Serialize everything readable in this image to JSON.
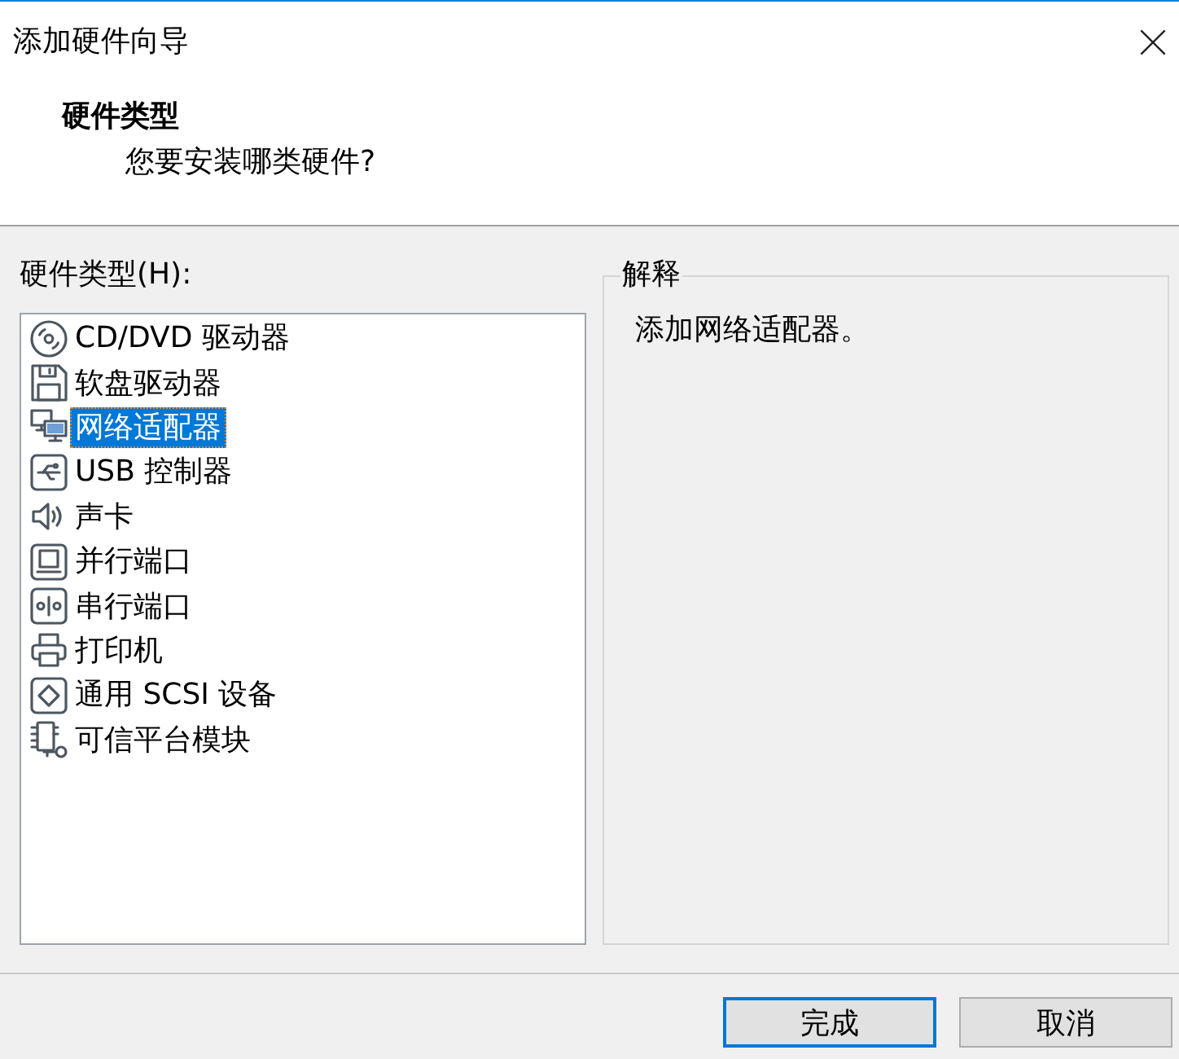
{
  "window": {
    "title": "添加硬件向导"
  },
  "header": {
    "title": "硬件类型",
    "subtitle": "您要安装哪类硬件?"
  },
  "hardware_list": {
    "label": "硬件类型(H):",
    "items": [
      {
        "label": "CD/DVD 驱动器",
        "kind": "disc",
        "selected": false
      },
      {
        "label": "软盘驱动器",
        "kind": "floppy",
        "selected": false
      },
      {
        "label": "网络适配器",
        "kind": "network",
        "selected": true
      },
      {
        "label": "USB 控制器",
        "kind": "usb",
        "selected": false
      },
      {
        "label": "声卡",
        "kind": "sound",
        "selected": false
      },
      {
        "label": "并行端口",
        "kind": "parallel",
        "selected": false
      },
      {
        "label": "串行端口",
        "kind": "serial",
        "selected": false
      },
      {
        "label": "打印机",
        "kind": "printer",
        "selected": false
      },
      {
        "label": "通用 SCSI 设备",
        "kind": "scsi",
        "selected": false
      },
      {
        "label": "可信平台模块",
        "kind": "tpm",
        "selected": false
      }
    ]
  },
  "explanation": {
    "title": "解释",
    "text": "添加网络适配器。"
  },
  "buttons": [
    {
      "label": "完成",
      "default": true
    },
    {
      "label": "取消",
      "default": false
    }
  ]
}
